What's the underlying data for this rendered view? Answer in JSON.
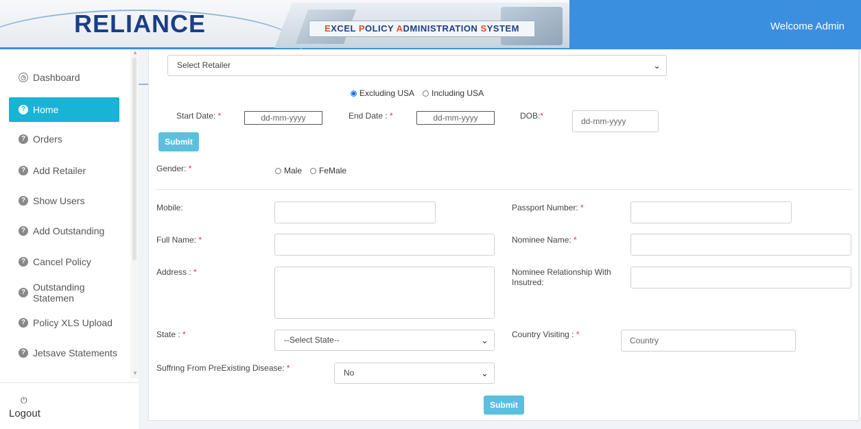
{
  "header": {
    "logo_text": "RELIANCE",
    "banner_title_parts": [
      "E",
      "XCEL ",
      "P",
      "OLICY ",
      "A",
      "DMINISTRATION ",
      "S",
      "YSTEM"
    ],
    "welcome": "Welcome Admin"
  },
  "sidebar": {
    "items": [
      {
        "label": "Dashboard",
        "icon": "dashboard-icon"
      },
      {
        "label": "Home",
        "icon": "help-circle-icon"
      },
      {
        "label": "Orders",
        "icon": "help-circle-icon"
      },
      {
        "label": "Add Retailer",
        "icon": "help-circle-icon"
      },
      {
        "label": "Show Users",
        "icon": "help-circle-icon"
      },
      {
        "label": "Add Outstanding",
        "icon": "help-circle-icon"
      },
      {
        "label": "Cancel Policy",
        "icon": "help-circle-icon"
      },
      {
        "label": "Outstanding Statemen",
        "icon": "help-circle-icon"
      },
      {
        "label": "Policy XLS Upload",
        "icon": "help-circle-icon"
      },
      {
        "label": "Jetsave Statements",
        "icon": "help-circle-icon"
      }
    ],
    "active": "Home",
    "logout_icon": "⏻",
    "logout_label": "Logout"
  },
  "form": {
    "retailer_select": "Select Retailer",
    "region_options": [
      "Excluding USA",
      "Including USA"
    ],
    "region_selected": "Excluding USA",
    "start_date_label": "Start Date:",
    "start_date_placeholder": "dd-mm-yyyy",
    "end_date_label": "End Date :",
    "end_date_placeholder": "dd-mm-yyyy",
    "dob_label": "DOB:",
    "dob_placeholder": "dd-mm-yyyy",
    "submit_top": "Submit",
    "gender_label": "Gender:",
    "gender_options": [
      "Male",
      "FeMale"
    ],
    "mobile_label": "Mobile:",
    "passport_label": "Passport Number:",
    "full_name_label": "Full Name:",
    "nominee_name_label": "Nominee Name:",
    "address_label": "Address :",
    "nominee_relationship_label_line1": "Nominee Relationship With",
    "nominee_relationship_label_line2": "Insutred:",
    "state_label": "State :",
    "state_select": "--Select State--",
    "country_label": "Country Visiting :",
    "country_placeholder": "Country",
    "disease_label": "Suffring From PreExisting Disease:",
    "disease_select": "No",
    "submit_bottom": "Submit",
    "required_mark": "*"
  },
  "colors": {
    "header_blue": "#3b8fdf",
    "active_nav": "#17b4d6",
    "button": "#5bc0de",
    "required": "#ee3333",
    "logo": "#1b3e86"
  }
}
